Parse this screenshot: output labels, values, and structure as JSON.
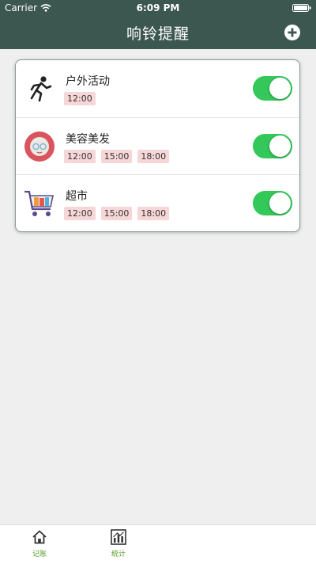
{
  "status_bar": {
    "carrier": "Carrier",
    "time": "6:09 PM"
  },
  "nav": {
    "title": "响铃提醒",
    "add_icon": "plus-circle-icon"
  },
  "reminders": [
    {
      "title": "户外活动",
      "icon": "running-person-icon",
      "times": [
        "12:00"
      ],
      "enabled": true
    },
    {
      "title": "美容美发",
      "icon": "beauty-avatar-icon",
      "times": [
        "12:00",
        "15:00",
        "18:00"
      ],
      "enabled": true
    },
    {
      "title": "超市",
      "icon": "shopping-cart-icon",
      "times": [
        "12:00",
        "15:00",
        "18:00"
      ],
      "enabled": true
    }
  ],
  "tabbar": {
    "items": [
      {
        "label": "记账",
        "icon": "home-icon"
      },
      {
        "label": "统计",
        "icon": "bar-chart-icon"
      }
    ]
  },
  "colors": {
    "header_bg": "#3c5650",
    "toggle_on": "#34c759",
    "tag_bg": "#f6d6d6",
    "tab_label": "#5a9c2c"
  }
}
